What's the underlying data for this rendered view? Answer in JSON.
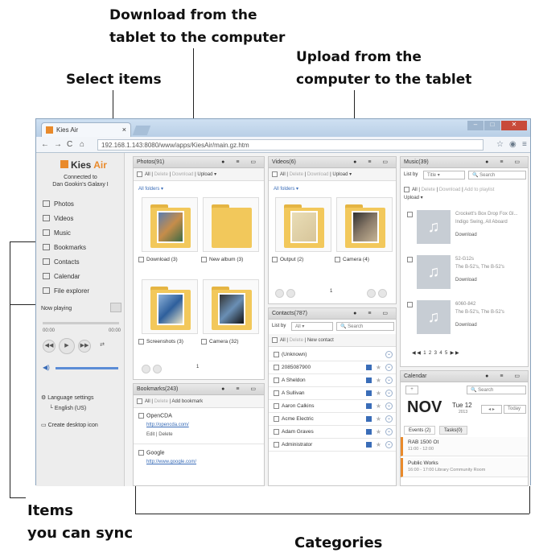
{
  "callouts": {
    "download_line1": "Download from the",
    "download_line2": "tablet to the computer",
    "upload_line1": "Upload from the",
    "upload_line2": "computer to the tablet",
    "select_items": "Select items",
    "items_sync_line1": "Items",
    "items_sync_line2": "you can sync",
    "categories": "Categories"
  },
  "browser": {
    "tab_title": "Kies Air",
    "tab_close": "×",
    "url": "192.168.1.143:8080/www/apps/KiesAir/main.gz.htm"
  },
  "sidebar": {
    "logo_kies": "Kies",
    "logo_air": "Air",
    "connected_line1": "Connected to",
    "connected_line2": "Dan Gookin's Galaxy I",
    "items": [
      {
        "label": "Photos"
      },
      {
        "label": "Videos"
      },
      {
        "label": "Music"
      },
      {
        "label": "Bookmarks"
      },
      {
        "label": "Contacts"
      },
      {
        "label": "Calendar"
      },
      {
        "label": "File explorer"
      }
    ],
    "now_playing": "Now playing",
    "time_start": "00:00",
    "time_end": "00:00",
    "language_settings": "Language settings",
    "language_value": "English (US)",
    "create_desktop_icon": "Create desktop icon"
  },
  "photos": {
    "title": "Photos(91)",
    "toolbar_all": "All",
    "toolbar_delete": "Delete",
    "toolbar_download": "Download",
    "toolbar_upload": "Upload",
    "all_folders": "All folders",
    "folders": [
      {
        "label": "Download (3)"
      },
      {
        "label": "New album (3)"
      },
      {
        "label": "Screenshots (3)"
      },
      {
        "label": "Camera (32)"
      }
    ],
    "page": "1"
  },
  "videos": {
    "title": "Videos(6)",
    "toolbar_all": "All",
    "toolbar_delete": "Delete",
    "toolbar_download": "Download",
    "toolbar_upload": "Upload",
    "all_folders": "All folders",
    "folders": [
      {
        "label": "Output (2)"
      },
      {
        "label": "Camera (4)"
      }
    ],
    "page": "1"
  },
  "music": {
    "title": "Music(39)",
    "list_by": "List by",
    "list_by_value": "Title",
    "search_placeholder": "Search",
    "toolbar_all": "All",
    "toolbar_delete": "Delete",
    "toolbar_download": "Download",
    "toolbar_add": "Add to playlist",
    "toolbar_upload": "Upload",
    "items": [
      {
        "title": "Crockett's Box Drop Fox Gl...",
        "sub": "Indigo Swing, All Aboard",
        "action": "Download"
      },
      {
        "title": "52-G12s",
        "sub": "The B-52's, The B-52's",
        "action": "Download"
      },
      {
        "title": "6060-842",
        "sub": "The B-52's, The B-52's",
        "action": "Download"
      }
    ],
    "pages": [
      "1",
      "2",
      "3",
      "4",
      "5"
    ]
  },
  "contacts": {
    "title": "Contacts(787)",
    "list_by": "List by",
    "list_by_value": "All",
    "search_placeholder": "Search",
    "toolbar_all": "All",
    "toolbar_delete": "Delete",
    "toolbar_new": "New contact",
    "rows": [
      {
        "name": "(Unknown)"
      },
      {
        "name": "2085087900"
      },
      {
        "name": "A Sheldon"
      },
      {
        "name": "A Sullivan"
      },
      {
        "name": "Aaron Calkins"
      },
      {
        "name": "Acme Electric"
      },
      {
        "name": "Adam Graves"
      },
      {
        "name": "Administrator"
      }
    ]
  },
  "bookmarks": {
    "title": "Bookmarks(243)",
    "toolbar_all": "All",
    "toolbar_delete": "Delete",
    "toolbar_add": "Add bookmark",
    "items": [
      {
        "name": "OpenCDA",
        "url": "http://opencda.com/",
        "actions": "Edit | Delete"
      },
      {
        "name": "Google",
        "url": "http://www.google.com/"
      }
    ]
  },
  "calendar": {
    "title": "Calendar",
    "search_placeholder": "Search",
    "month": "NOV",
    "day": "Tue 12",
    "year": "2013",
    "today": "Today",
    "tab_events": "Events (2)",
    "tab_tasks": "Tasks(0)",
    "events": [
      {
        "title": "RAB 1500 Ot",
        "time": "11:00 - 12:00"
      },
      {
        "title": "Public Works",
        "time": "16:00 - 17:00 Library Community Room"
      }
    ]
  }
}
